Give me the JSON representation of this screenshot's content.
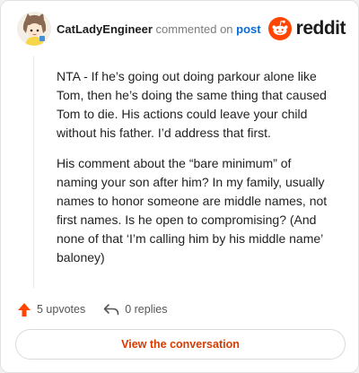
{
  "header": {
    "username": "CatLadyEngineer",
    "action_text": "commented on",
    "post_link": "post",
    "logo_text": "reddit"
  },
  "comment": {
    "paragraphs": [
      "NTA - If he’s going out doing parkour alone like Tom, then he’s doing the same thing that caused Tom to die. His actions could leave your child without his father. I’d address that first.",
      "His comment about the “bare minimum” of naming your son after him? In my family, usually names to honor someone are middle names, not first names. Is he open to compromising? (And none of that ‘I’m calling him by his middle name’ baloney)"
    ]
  },
  "actions": {
    "upvotes": "5 upvotes",
    "replies": "0 replies"
  },
  "button": {
    "label": "View the conversation"
  },
  "icons": {
    "upvote": "upvote-arrow-icon",
    "reply": "reply-arrow-icon",
    "logo": "reddit-snoo-icon"
  },
  "colors": {
    "brand": "#ff4500",
    "link": "#0a6bd6",
    "button_text": "#d93a00"
  }
}
